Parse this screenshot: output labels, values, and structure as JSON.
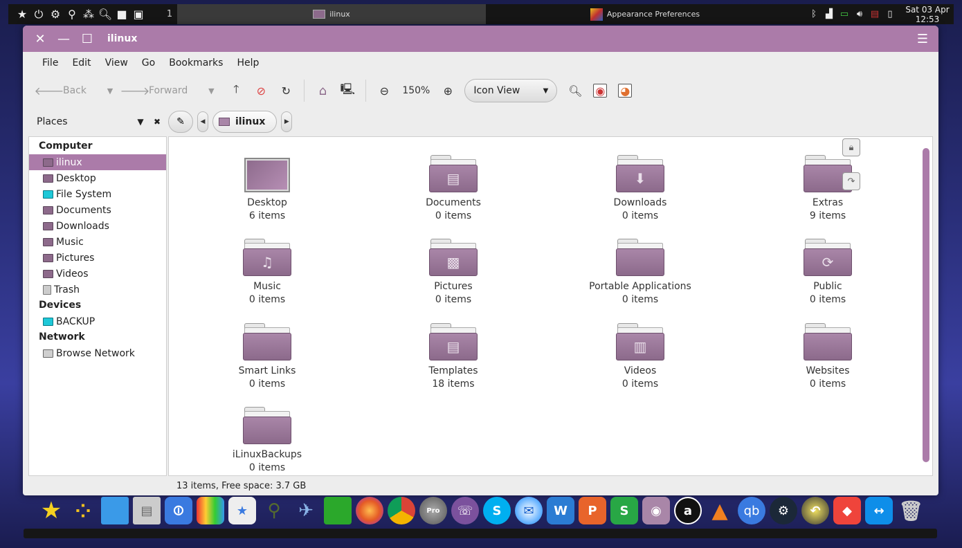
{
  "top_panel": {
    "workspace": "1",
    "tasks": [
      {
        "label": "ilinux",
        "active": true
      },
      {
        "label": "Appearance Preferences",
        "active": false
      }
    ],
    "clock": {
      "date": "Sat 03 Apr",
      "time": "12:53"
    },
    "launcher_icons": [
      "star-icon",
      "power-icon",
      "toggle-icon",
      "binoculars-icon",
      "network-icon",
      "search-icon",
      "folder-icon",
      "window-icon"
    ],
    "tray_icons": [
      "bluetooth-icon",
      "signal-icon",
      "battery-icon",
      "volume-icon",
      "flag-icon",
      "clipboard-icon"
    ]
  },
  "window": {
    "title": "ilinux",
    "menu": [
      "File",
      "Edit",
      "View",
      "Go",
      "Bookmarks",
      "Help"
    ],
    "toolbar": {
      "back": "Back",
      "forward": "Forward",
      "zoom": "150%",
      "view_mode": "Icon View"
    },
    "places_label": "Places",
    "breadcrumb": "ilinux",
    "sidebar": {
      "computer_heading": "Computer",
      "computer_items": [
        "ilinux",
        "Desktop",
        "File System",
        "Documents",
        "Downloads",
        "Music",
        "Pictures",
        "Videos",
        "Trash"
      ],
      "devices_heading": "Devices",
      "devices_items": [
        "BACKUP"
      ],
      "network_heading": "Network",
      "network_items": [
        "Browse Network"
      ]
    },
    "files": [
      {
        "name": "Desktop",
        "count": "6 items"
      },
      {
        "name": "Documents",
        "count": "0 items"
      },
      {
        "name": "Downloads",
        "count": "0 items"
      },
      {
        "name": "Extras",
        "count": "9 items"
      },
      {
        "name": "Music",
        "count": "0 items"
      },
      {
        "name": "Pictures",
        "count": "0 items"
      },
      {
        "name": "Portable Applications",
        "count": "0 items"
      },
      {
        "name": "Public",
        "count": "0 items"
      },
      {
        "name": "Smart Links",
        "count": "0 items"
      },
      {
        "name": "Templates",
        "count": "18 items"
      },
      {
        "name": "Videos",
        "count": "0 items"
      },
      {
        "name": "Websites",
        "count": "0 items"
      },
      {
        "name": "iLinuxBackups",
        "count": "0 items"
      }
    ],
    "status": "13 items, Free space: 3.7 GB"
  },
  "dock": {
    "icons": [
      "star-icon",
      "dots-icon",
      "window-icon",
      "cabinet-icon",
      "toggle-icon",
      "palette-icon",
      "store-icon",
      "binoculars-icon",
      "rocket-icon",
      "pipe-icon",
      "firefox-icon",
      "chrome-icon",
      "earth-pro-icon",
      "viber-icon",
      "skype-icon",
      "thunderbird-icon",
      "writer-icon",
      "presentation-icon",
      "spreadsheet-icon",
      "camera-icon",
      "amazon-icon",
      "vlc-icon",
      "qbittorrent-icon",
      "steam-icon",
      "backup-icon",
      "anydesk-icon",
      "teamviewer-icon",
      "trash-icon"
    ],
    "dock_labels": {
      "amazon": "a",
      "qb": "qb",
      "writer": "W",
      "pres": "P",
      "sheet": "S"
    }
  },
  "colors": {
    "accent": "#ab7ba9",
    "folder": "#8c6a8b",
    "panel": "#151515"
  }
}
